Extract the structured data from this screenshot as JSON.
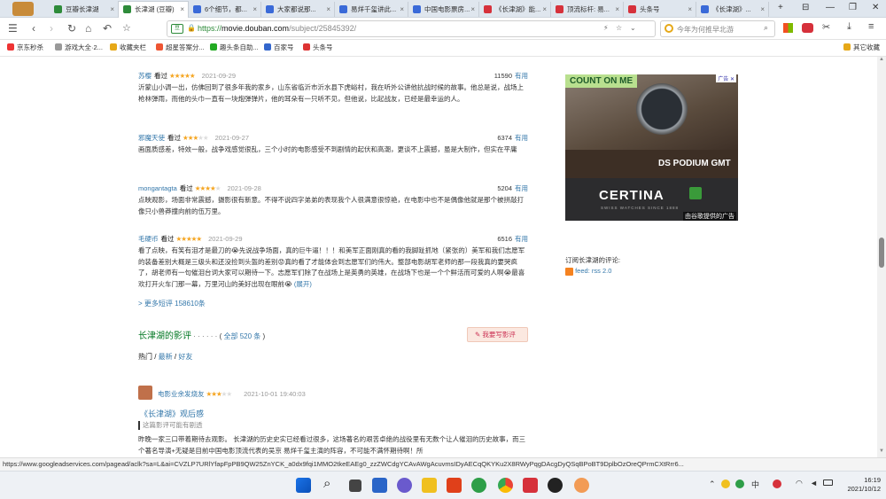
{
  "browser": {
    "tabs": [
      {
        "label": "豆瓣长津湖",
        "color": "#2e8b3a"
      },
      {
        "label": "长津湖 (豆瓣)",
        "color": "#2e8b3a",
        "active": true
      },
      {
        "label": "6个细节，都...",
        "color": "#3a6ad8"
      },
      {
        "label": "大家都说那...",
        "color": "#3a6ad8"
      },
      {
        "label": "易烊千玺讲此...",
        "color": "#3a6ad8"
      },
      {
        "label": "中国电影票房...",
        "color": "#3a6ad8"
      },
      {
        "label": "《长津湖》能...",
        "color": "#d6313b"
      },
      {
        "label": "顶流标杆: 易...",
        "color": "#d6313b"
      },
      {
        "label": "头条号",
        "color": "#d6313b"
      },
      {
        "label": "《长津湖》...",
        "color": "#3a6ad8"
      }
    ],
    "url_prefix": "https://",
    "url_domain": "movie.douban.com",
    "url_path": "/subject/25845392/",
    "search_placeholder": "今年为何推早北游",
    "bookmarks": [
      {
        "label": "京东秒杀",
        "color": "#e33"
      },
      {
        "label": "游戏大全·2...",
        "color": "#999"
      },
      {
        "label": "收藏夹栏",
        "color": "#e6a817"
      },
      {
        "label": "超星答案分...",
        "color": "#e53"
      },
      {
        "label": "趣头条自助...",
        "color": "#2a2"
      },
      {
        "label": "百家号",
        "color": "#36c"
      },
      {
        "label": "头条号",
        "color": "#d33"
      }
    ],
    "other_bookmarks": "其它收藏"
  },
  "comments": [
    {
      "user": "苏樱",
      "status": "看过",
      "stars": 5,
      "date": "2021-09-29",
      "votes": "11590",
      "useful": "有用",
      "text": "沂蒙山小调一出，仿佛回到了很多年我的家乡，山东省临沂市沂水县下虎峪村，我在听外公讲他抗战时候的故事。他总是说，战场上枪林弹雨，而他的头巾一直有一块炮弹弹片，他的耳朵有一只听不见，但他说，比起战友，已经是最幸运的人。"
    },
    {
      "user": "邪魔天使",
      "status": "看过",
      "stars": 3,
      "date": "2021-09-27",
      "votes": "6374",
      "useful": "有用",
      "text": "画面质感差，特效一般，战争戏感觉很乱，三个小时的电影感受不到剧情的起伏和高潮，更谈不上震撼，虽是大制作，但实在平庸"
    },
    {
      "user": "mongantagta",
      "status": "看过",
      "stars": 4,
      "date": "2021-09-28",
      "votes": "5204",
      "useful": "有用",
      "text": "点映观影，场面非常震撼，摄影很有新意。不得不说四字弟弟的表现我个人很满意很惊艳，在电影中也不是偶像他就是那个被拼敲打像只小兽莽撞向前的伍万里。"
    },
    {
      "user": "毛硬币",
      "status": "看过",
      "stars": 5,
      "date": "2021-09-29",
      "votes": "6516",
      "useful": "有用",
      "text": "看了点映，有笑有泪才是最刀的😭先说战争场面，真的巨牛逼！！！和美军正面刚真的看的我脚趾抓地（紧张的）美军和我们志愿军的装备差别大概是三级头和还没捡到头盔的差别😟真的看了才能体会到志愿军们的伟大。整部电影胡军老师的那一段我真的要哭疯了，胡老师有一句催泪台词大家可以期待一下。志愿军们除了在战场上是英勇的英雄，在战场下也是一个个鲜活而可爱的人啊😭最喜欢打开火车门那一幕，万里河山的美好出现在眼前😭",
      "expand": "(展开)"
    }
  ],
  "more_short": "> 更多短评 158610条",
  "reviews_section": {
    "title": "长津湖的影评",
    "dots": "· · · · · ·",
    "count_open": "( ",
    "count": "全部 520 条",
    "count_close": " )",
    "write_button": "我要写影评",
    "filters": [
      "热门",
      "最新",
      "好友"
    ],
    "filter_sep": " / "
  },
  "review": {
    "user": "电影业余发烧友",
    "stars": 3,
    "date": "2021-10-01 19:40:03",
    "title": "《长津湖》观后感",
    "spoiler": "这篇影评可能有剧透",
    "text": "昨晚一家三口带着期待去观影。 长津湖的历史史实已经看过很多，这场著名的艰苦卓绝的战役里有无数个让人催泪的历史故事，而三个著名导演+无疑是目前中国电影顶流代表的吴京 易烊千玺主演的阵容，不可能不满怀期待啊！所"
  },
  "sidebar": {
    "ad_top_text": "COUNT ON ME",
    "ad_model": "DS PODIUM GMT",
    "ad_brand": "CERTINA",
    "ad_tagline": "SWISS WATCHES SINCE 1888",
    "ad_footer": "由谷歌提供的广告",
    "ad_badge": "广告",
    "subscribe_label": "订阅长津湖的评论:",
    "rss_label": "feed: rss 2.0"
  },
  "statusbar": {
    "url": "https://www.googleadservices.com/pagead/aclk?sa=L&ai=CVZLP7URlYfapFpPB9QW25ZnYCK_a0dx9fqi1MMO2tkeEAEg0_zzZWCdgYCAvAWgAcuvmsIDyAECqQKYKu2X8RWyPqgDAcgDyQSqBPoBT9DplbOzOreQPrmCXtRrr6..."
  },
  "taskbar": {
    "time": "16:19",
    "date": "2021/10/12",
    "lang": "中"
  }
}
